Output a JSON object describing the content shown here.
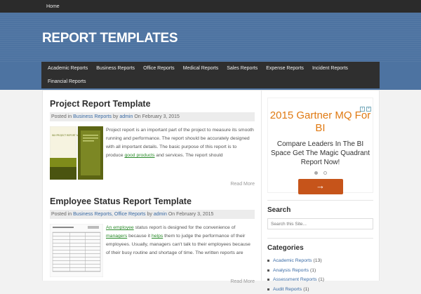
{
  "topbar": {
    "home": "Home"
  },
  "site": {
    "title": "REPORT TEMPLATES"
  },
  "nav": [
    "Academic Reports",
    "Business Reports",
    "Office Reports",
    "Medical Reports",
    "Sales Reports",
    "Expense Reports",
    "Incident Reports",
    "Financial Reports"
  ],
  "posts": [
    {
      "title": "Project Report Template",
      "meta_prefix": "Posted in",
      "categories": "Business Reports",
      "by": "by",
      "author": "admin",
      "on": "On",
      "date": "February 3, 2015",
      "excerpt_a": "Project report is an important part of the project to measure its smooth running and performance. The report should be accurately designed with all important details. The basic purpose of this report is to produce ",
      "excerpt_link": "good products",
      "excerpt_b": " and services. The report should",
      "read_more": "Read More",
      "thumb_text": "WX PROJECT REPORT for Year 2015"
    },
    {
      "title": "Employee Status Report Template",
      "meta_prefix": "Posted in",
      "categories": "Business Reports, Office Reports",
      "by": "by",
      "author": "admin",
      "on": "On",
      "date": "February 3, 2015",
      "excerpt_link1": "An employee",
      "excerpt_a": " status report is designed for the convenience of ",
      "excerpt_link2": "managers",
      "excerpt_b": " because it ",
      "excerpt_link3": "helps",
      "excerpt_c": " them to judge the performance of their employees. Usually, managers can't talk to their employees because of their busy routine and shortage of time. The written reports are",
      "read_more": "Read More"
    }
  ],
  "ad": {
    "title": "2015 Gartner MQ For BI",
    "description": "Compare Leaders In The BI Space Get The Magic Quadrant Report Now!",
    "button": "→"
  },
  "search": {
    "title": "Search",
    "placeholder": "Search this Site..."
  },
  "categories": {
    "title": "Categories",
    "items": [
      {
        "label": "Academic Reports",
        "count": "(13)"
      },
      {
        "label": "Analysis Reports",
        "count": "(1)"
      },
      {
        "label": "Assessment Reports",
        "count": "(1)"
      },
      {
        "label": "Audit Reports",
        "count": "(1)"
      }
    ]
  },
  "colors": {
    "header_blue": "#4d73a1",
    "nav_dark": "#2f2f2f",
    "ad_orange": "#e07a13",
    "link_blue": "#3a6ba5"
  }
}
